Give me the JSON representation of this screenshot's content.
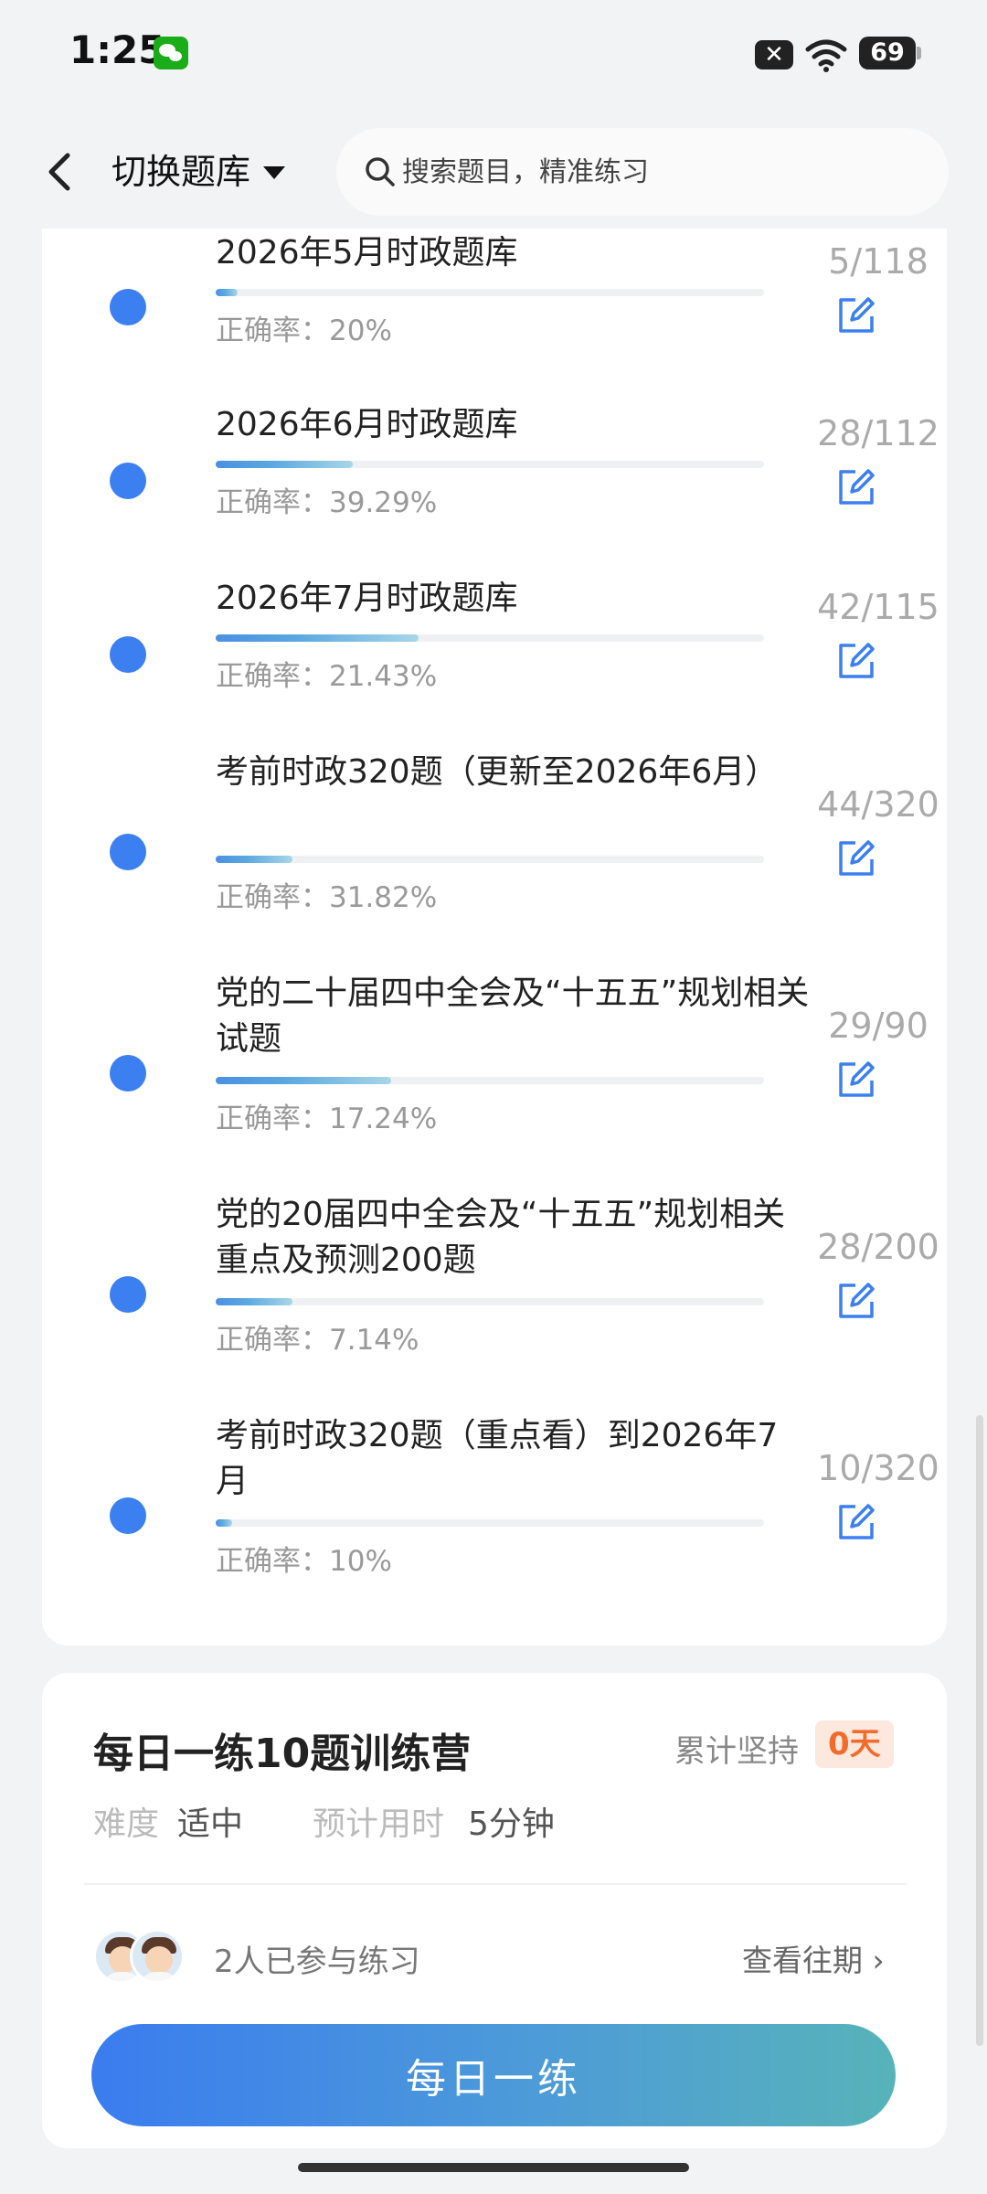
{
  "status_bar": {
    "time": "1:25",
    "battery": "69"
  },
  "header": {
    "title": "切换题库",
    "search_placeholder": "搜索题目，精准练习"
  },
  "bank_list": [
    {
      "title": "2026年5月时政题库",
      "accuracy": "正确率：20%",
      "count": "5/118",
      "progress": 0.04
    },
    {
      "title": "2026年6月时政题库",
      "accuracy": "正确率：39.29%",
      "count": "28/112",
      "progress": 0.25
    },
    {
      "title": "2026年7月时政题库",
      "accuracy": "正确率：21.43%",
      "count": "42/115",
      "progress": 0.37
    },
    {
      "title": "考前时政320题（更新至2026年6月）",
      "accuracy": "正确率：31.82%",
      "count": "44/320",
      "progress": 0.14
    },
    {
      "title": "党的二十届四中全会及“十五五”规划相关试题",
      "accuracy": "正确率：17.24%",
      "count": "29/90",
      "progress": 0.32
    },
    {
      "title": "党的20届四中全会及“十五五”规划相关重点及预测200题",
      "accuracy": "正确率：7.14%",
      "count": "28/200",
      "progress": 0.14
    },
    {
      "title": "考前时政320题（重点看）到2026年7月",
      "accuracy": "正确率：10%",
      "count": "10/320",
      "progress": 0.03
    }
  ],
  "daily": {
    "title": "每日一练10题训练营",
    "persist_label": "累计坚持",
    "persist_value": "0天",
    "difficulty_label": "难度",
    "difficulty_value": "适中",
    "time_label": "预计用时",
    "time_value": "5分钟",
    "participants": "2人已参与练习",
    "history_link": "查看往期 ›",
    "button_label": "每日一练"
  },
  "colors": {
    "accent": "#3b7ff0",
    "badge_text": "#f26b2a",
    "badge_bg": "#fde8dd"
  }
}
